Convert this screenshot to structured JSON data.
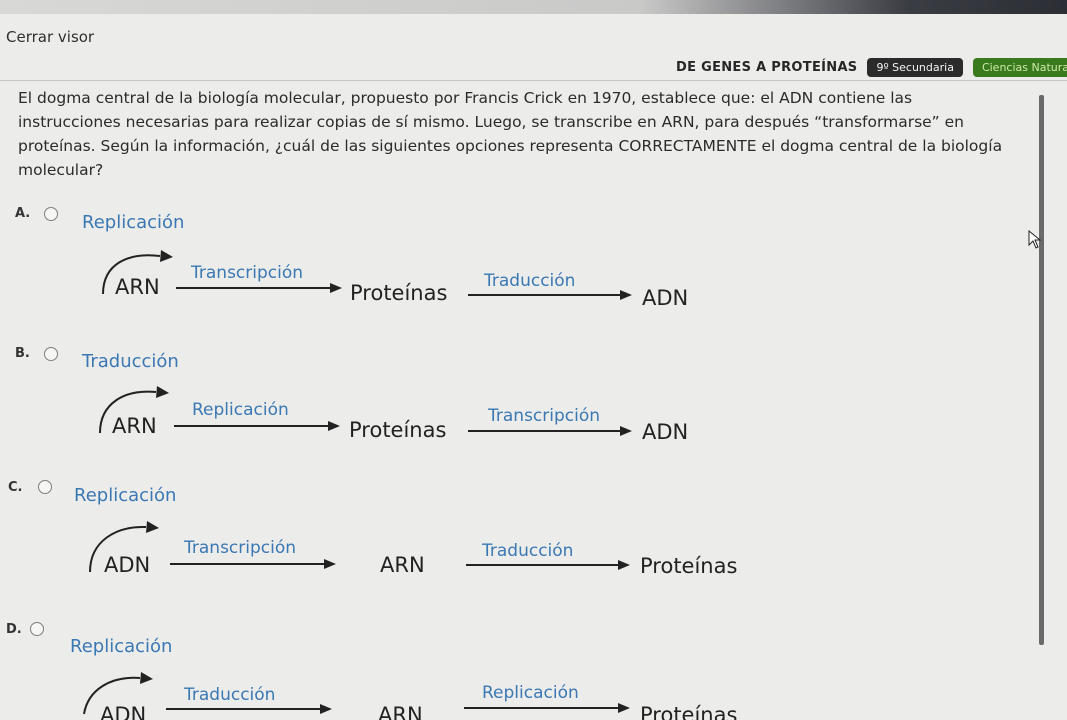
{
  "header": {
    "close_label": "Cerrar visor",
    "lesson_title": "DE GENES A PROTEÍNAS",
    "grade_badge": "9º Secundaria",
    "subject_badge": "Ciencias Naturales"
  },
  "question": {
    "text": "El dogma central de la biología molecular, propuesto por Francis Crick en 1970, establece que: el ADN contiene las instrucciones necesarias para realizar copias de sí mismo. Luego, se transcribe en ARN, para después “transformarse” en proteínas. Según la información, ¿cuál de las siguientes opciones representa CORRECTAMENTE el dogma central de la biología molecular?"
  },
  "options": [
    {
      "letter": "A.",
      "loop_label": "Replicación",
      "node1": "ARN",
      "arrow1": "Transcripción",
      "node2": "Proteínas",
      "arrow2": "Traducción",
      "node3": "ADN"
    },
    {
      "letter": "B.",
      "loop_label": "Traducción",
      "node1": "ARN",
      "arrow1": "Replicación",
      "node2": "Proteínas",
      "arrow2": "Transcripción",
      "node3": "ADN"
    },
    {
      "letter": "C.",
      "loop_label": "Replicación",
      "node1": "ADN",
      "arrow1": "Transcripción",
      "node2": "ARN",
      "arrow2": "Traducción",
      "node3": "Proteínas"
    },
    {
      "letter": "D.",
      "loop_label": "Replicación",
      "node1": "ADN",
      "arrow1": "Traducción",
      "node2": "ARN",
      "arrow2": "Replicación",
      "node3": "Proteínas"
    }
  ],
  "colors": {
    "accent_blue": "#3a78b4",
    "subject_green": "#3a7a1f"
  }
}
